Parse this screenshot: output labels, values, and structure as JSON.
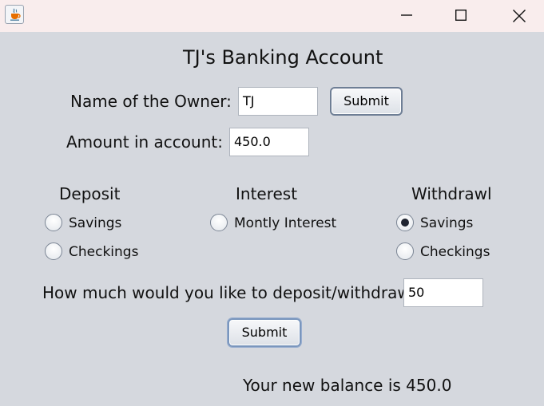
{
  "window": {
    "app_icon": "java-cup-icon",
    "controls": [
      "minimize-icon",
      "maximize-icon",
      "close-icon"
    ]
  },
  "header": {
    "title": "TJ's Banking Account"
  },
  "owner": {
    "label": "Name of the Owner:",
    "value": "TJ",
    "submit_label": "Submit"
  },
  "amount": {
    "label": "Amount in account:",
    "value": "450.0"
  },
  "deposit": {
    "heading": "Deposit",
    "options": [
      {
        "label": "Savings",
        "checked": false
      },
      {
        "label": "Checkings",
        "checked": false
      }
    ]
  },
  "interest": {
    "heading": "Interest",
    "options": [
      {
        "label": "Montly Interest",
        "checked": false
      }
    ]
  },
  "withdrawl": {
    "heading": "Withdrawl",
    "options": [
      {
        "label": "Savings",
        "checked": true
      },
      {
        "label": "Checkings",
        "checked": false
      }
    ]
  },
  "transaction": {
    "label": "How much would you like to deposit/withdrawl:",
    "value": "50",
    "submit_label": "Submit"
  },
  "result": {
    "message": "Your new balance is 450.0"
  }
}
